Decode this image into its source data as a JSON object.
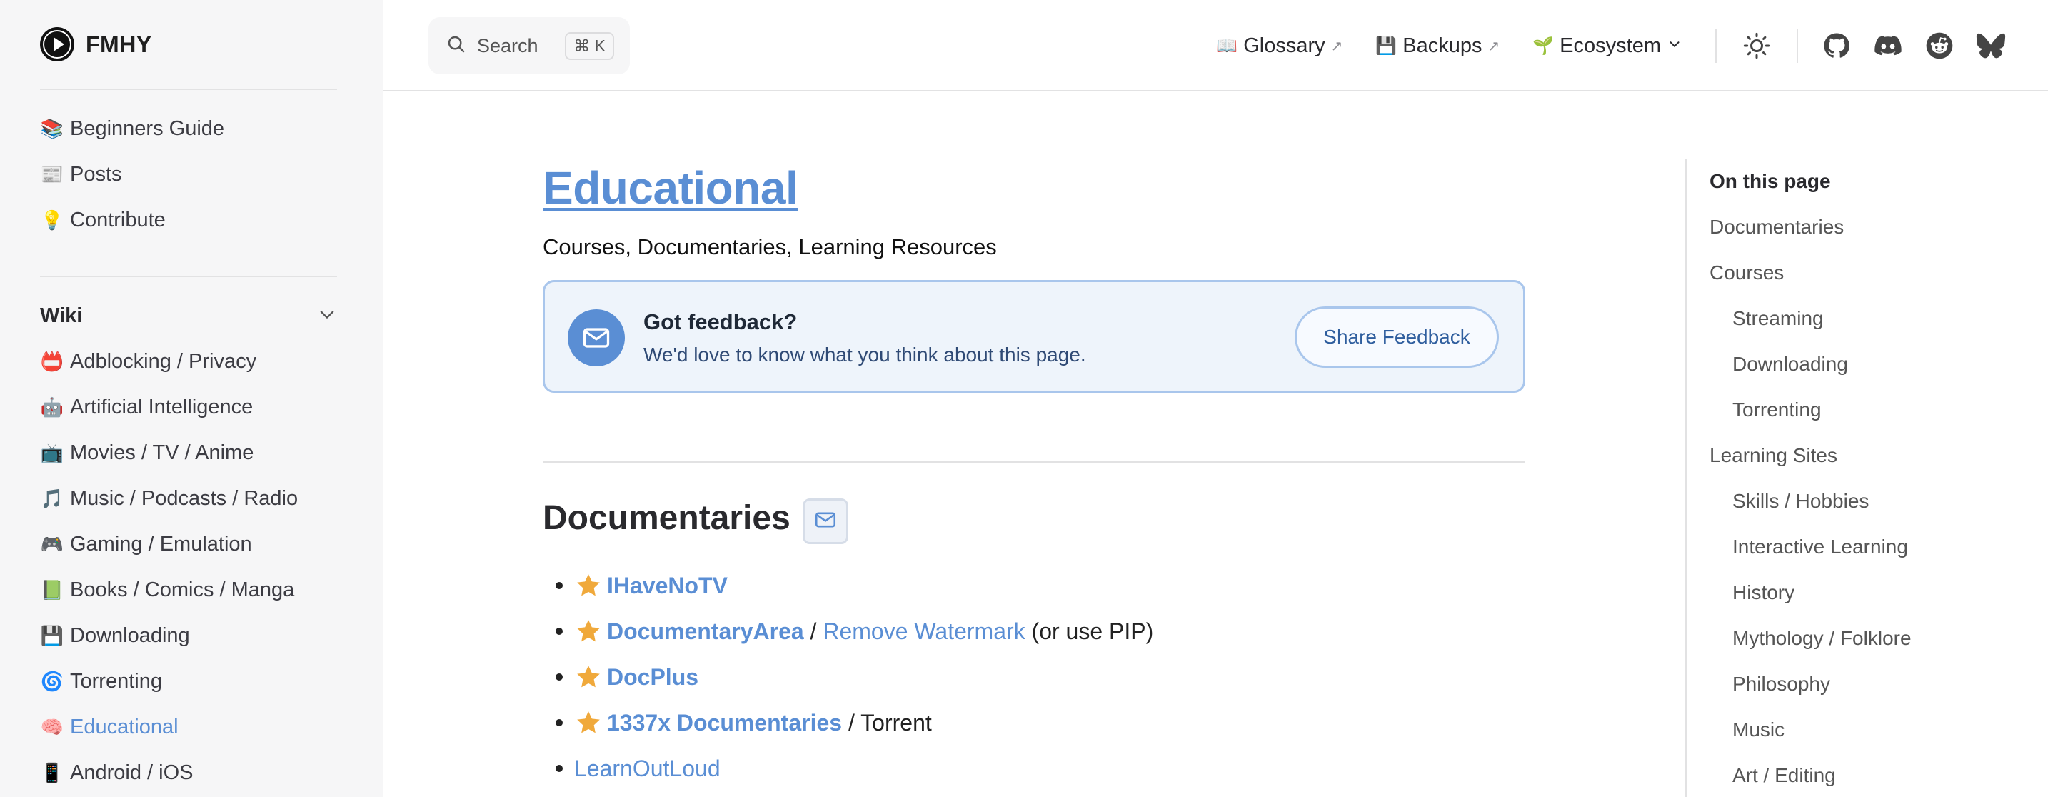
{
  "brand": {
    "name": "FMHY"
  },
  "sidebar": {
    "top_items": [
      {
        "emoji": "📚",
        "label": "Beginners Guide"
      },
      {
        "emoji": "📰",
        "label": "Posts"
      },
      {
        "emoji": "💡",
        "label": "Contribute"
      }
    ],
    "section_title": "Wiki",
    "wiki_items": [
      {
        "emoji": "📛",
        "label": "Adblocking / Privacy"
      },
      {
        "emoji": "🤖",
        "label": "Artificial Intelligence"
      },
      {
        "emoji": "📺",
        "label": "Movies / TV / Anime"
      },
      {
        "emoji": "🎵",
        "label": "Music / Podcasts / Radio"
      },
      {
        "emoji": "🎮",
        "label": "Gaming / Emulation"
      },
      {
        "emoji": "📗",
        "label": "Books / Comics / Manga"
      },
      {
        "emoji": "💾",
        "label": "Downloading"
      },
      {
        "emoji": "🌀",
        "label": "Torrenting"
      },
      {
        "emoji": "🧠",
        "label": "Educational",
        "active": true
      },
      {
        "emoji": "📱",
        "label": "Android / iOS"
      }
    ]
  },
  "topnav": {
    "search_label": "Search",
    "search_shortcut": "⌘ K",
    "links": [
      {
        "emoji": "📖",
        "label": "Glossary",
        "external": "↗"
      },
      {
        "emoji": "💾",
        "label": "Backups",
        "external": "↗"
      },
      {
        "emoji": "🌱",
        "label": "Ecosystem",
        "dropdown": true
      }
    ],
    "icons": [
      "theme-toggle-sun-icon",
      "github-icon",
      "discord-icon",
      "reddit-icon",
      "bluesky-icon"
    ]
  },
  "main": {
    "title": "Educational",
    "subtitle": "Courses, Documentaries, Learning Resources",
    "feedback": {
      "title": "Got feedback?",
      "text": "We'd love to know what you think about this page.",
      "button": "Share Feedback"
    },
    "section_title": "Documentaries",
    "items": [
      {
        "starred": true,
        "primary": "IHaveNoTV"
      },
      {
        "starred": true,
        "primary": "DocumentaryArea",
        "sep": " / ",
        "secondary": "Remove Watermark",
        "suffix": " (or use PIP)"
      },
      {
        "starred": true,
        "primary": "DocPlus"
      },
      {
        "starred": true,
        "primary": "1337x Documentaries",
        "sep": " / Torrent"
      },
      {
        "starred": false,
        "primary": "LearnOutLoud"
      }
    ]
  },
  "toc": {
    "title": "On this page",
    "items": [
      {
        "label": "Documentaries",
        "level": 1
      },
      {
        "label": "Courses",
        "level": 1
      },
      {
        "label": "Streaming",
        "level": 2
      },
      {
        "label": "Downloading",
        "level": 2
      },
      {
        "label": "Torrenting",
        "level": 2
      },
      {
        "label": "Learning Sites",
        "level": 1
      },
      {
        "label": "Skills / Hobbies",
        "level": 2
      },
      {
        "label": "Interactive Learning",
        "level": 2
      },
      {
        "label": "History",
        "level": 2
      },
      {
        "label": "Mythology / Folklore",
        "level": 2
      },
      {
        "label": "Philosophy",
        "level": 2
      },
      {
        "label": "Music",
        "level": 2
      },
      {
        "label": "Art / Editing",
        "level": 2
      }
    ]
  },
  "colors": {
    "accent": "#5a8ed4",
    "sidebar_bg": "#f6f6f7",
    "feedback_bg": "#eef4fb",
    "star": "#f0a93b"
  }
}
